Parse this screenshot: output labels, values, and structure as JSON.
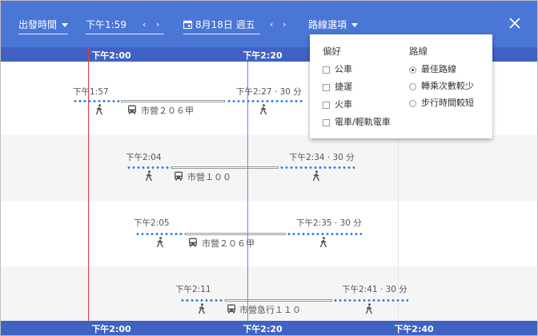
{
  "topbar": {
    "depart_label": "出發時間",
    "time_value": "下午1:59",
    "date_value": "8月18日 週五",
    "options_label": "路線選項",
    "prev": "‹",
    "next": "›"
  },
  "timeline": {
    "top_ticks": [
      "下午2:00",
      "下午2:20"
    ],
    "bottom_ticks": [
      "下午2:00",
      "下午2:20",
      "下午2:40"
    ]
  },
  "trips": [
    {
      "depart": "下午1:57",
      "arrive": "下午2:27 · 30 分",
      "route": "市營２０６甲"
    },
    {
      "depart": "下午2:04",
      "arrive": "下午2:34 · 30 分",
      "route": "市營１００"
    },
    {
      "depart": "下午2:05",
      "arrive": "下午2:35 · 30 分",
      "route": "市營２０６甲"
    },
    {
      "depart": "下午2:11",
      "arrive": "下午2:41 · 30 分",
      "route": "市營急行１１０"
    }
  ],
  "options_panel": {
    "prefer_title": "偏好",
    "prefer_items": [
      "公車",
      "捷運",
      "火車",
      "電車/輕軌電車"
    ],
    "route_title": "路線",
    "route_items": [
      "最佳路線",
      "轉乘次數較少",
      "步行時間較短"
    ],
    "selected_route": "最佳路線"
  },
  "colors": {
    "topbar": "#4a76d6",
    "timebar": "#3f62c3",
    "now_line": "#e53935",
    "walk_dots": "#2e7fe0"
  },
  "icons": {
    "calendar": "calendar-icon",
    "walk": "walk-icon",
    "bus": "bus-icon",
    "close": "close-icon",
    "dropdown": "chevron-down-icon"
  }
}
